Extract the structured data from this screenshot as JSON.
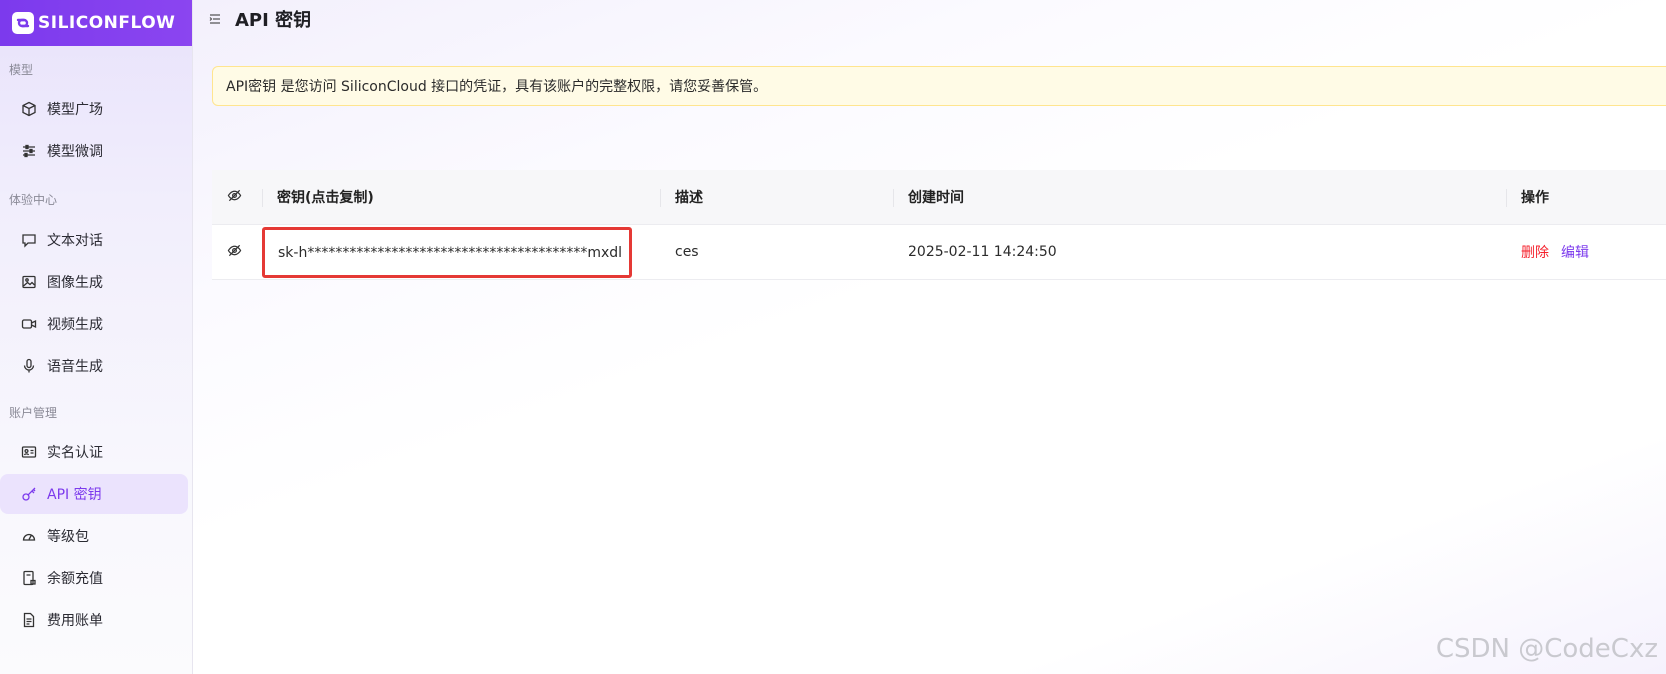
{
  "brand": {
    "name": "SILICONFLOW",
    "accent": "#7c3aed"
  },
  "sidebar": {
    "sections": [
      {
        "label": "模型"
      },
      {
        "label": "体验中心"
      },
      {
        "label": "账户管理"
      }
    ],
    "items": [
      {
        "label": "模型广场",
        "icon": "cube-icon"
      },
      {
        "label": "模型微调",
        "icon": "sliders-icon"
      },
      {
        "label": "文本对话",
        "icon": "chat-bubble-icon"
      },
      {
        "label": "图像生成",
        "icon": "image-icon"
      },
      {
        "label": "视频生成",
        "icon": "video-icon"
      },
      {
        "label": "语音生成",
        "icon": "microphone-icon"
      },
      {
        "label": "实名认证",
        "icon": "id-card-icon"
      },
      {
        "label": "API 密钥",
        "icon": "key-icon",
        "active": true
      },
      {
        "label": "等级包",
        "icon": "gauge-icon"
      },
      {
        "label": "余额充值",
        "icon": "wallet-icon"
      },
      {
        "label": "费用账单",
        "icon": "bill-icon"
      }
    ]
  },
  "header": {
    "title": "API 密钥"
  },
  "notice": {
    "text": "API密钥 是您访问 SiliconCloud 接口的凭证，具有该账户的完整权限，请您妥善保管。"
  },
  "table": {
    "columns": [
      "密钥(点击复制)",
      "描述",
      "创建时间",
      "操作"
    ],
    "rows": [
      {
        "key": "sk-h****************************************mxdl",
        "description": "ces",
        "created": "2025-02-11 14:24:50",
        "actions": {
          "delete": "删除",
          "edit": "编辑"
        }
      }
    ]
  },
  "watermark": "CSDN @CodeCxz"
}
